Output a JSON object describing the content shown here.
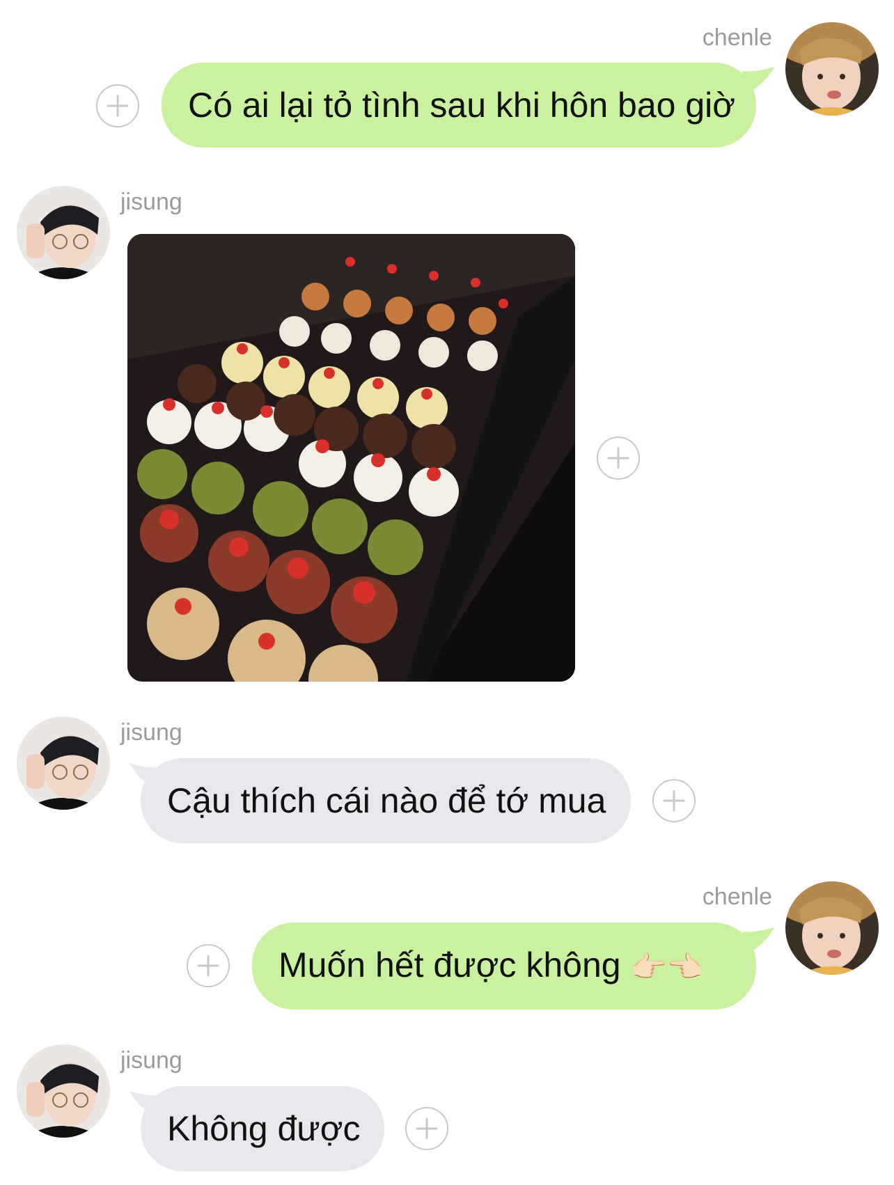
{
  "messages": [
    {
      "sender": "chenle",
      "side": "right",
      "type": "text",
      "text": "Có ai lại tỏ tình sau khi hôn bao giờ"
    },
    {
      "sender": "jisung",
      "side": "left",
      "type": "image",
      "image": "cake-display-photo"
    },
    {
      "sender": "jisung",
      "side": "left",
      "type": "text",
      "text": "Cậu thích cái nào để tớ mua"
    },
    {
      "sender": "chenle",
      "side": "right",
      "type": "text",
      "text": "Muốn hết được không",
      "emoji": "👉🏻👈🏻"
    },
    {
      "sender": "jisung",
      "side": "left",
      "type": "text",
      "text": "Không được"
    }
  ],
  "icons": {
    "add_reaction": "plus-circle-icon",
    "avatar_chenle": "avatar-photo",
    "avatar_jisung": "avatar-photo"
  },
  "colors": {
    "sent_bubble": "#c9f1a0",
    "received_bubble": "#e6e8ec",
    "name_label": "#9a9a9a",
    "plus_icon": "#c8c8c8"
  }
}
